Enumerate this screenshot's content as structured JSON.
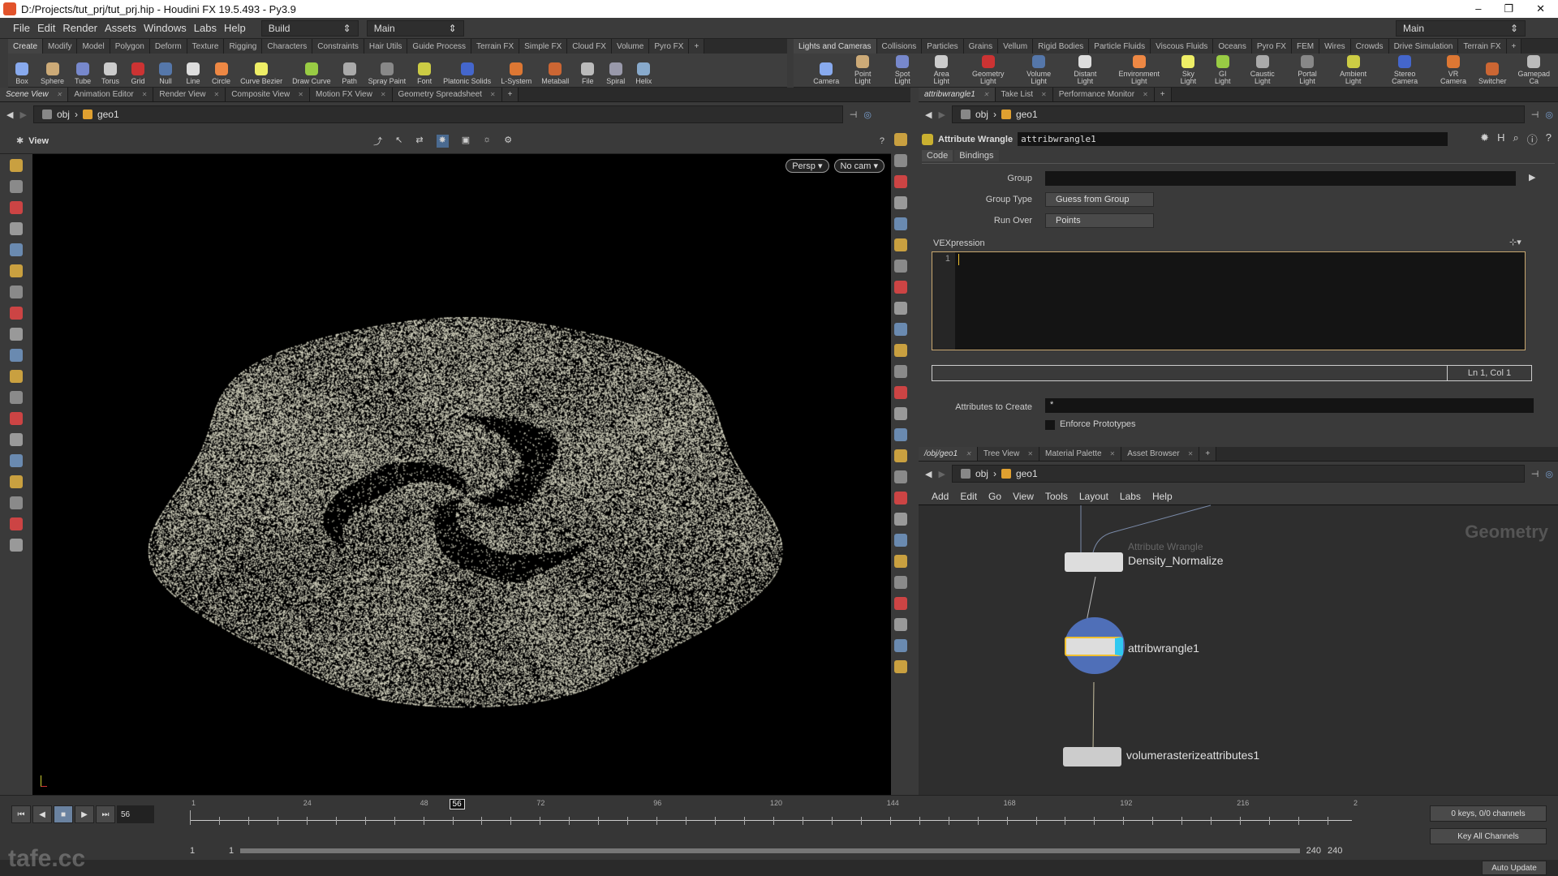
{
  "window": {
    "title": "D:/Projects/tut_prj/tut_prj.hip - Houdini FX 19.5.493 - Py3.9",
    "controls": [
      "–",
      "❐",
      "✕"
    ]
  },
  "menu": [
    "File",
    "Edit",
    "Render",
    "Assets",
    "Windows",
    "Labs",
    "Help"
  ],
  "desktop": "Build",
  "desktop_right": "Main",
  "desktop_far": "Main",
  "shelf_left": {
    "tabs": [
      "Create",
      "Modify",
      "Model",
      "Polygon",
      "Deform",
      "Texture",
      "Rigging",
      "Characters",
      "Constraints",
      "Hair Utils",
      "Guide Process",
      "Terrain FX",
      "Simple FX",
      "Cloud FX",
      "Volume",
      "Pyro FX"
    ],
    "tools": [
      "Box",
      "Sphere",
      "Tube",
      "Torus",
      "Grid",
      "Null",
      "Line",
      "Circle",
      "Curve Bezier",
      "Draw Curve",
      "Path",
      "Spray Paint",
      "Font",
      "Platonic Solids",
      "L-System",
      "Metaball",
      "File",
      "Spiral",
      "Helix"
    ]
  },
  "shelf_right": {
    "tabs": [
      "Lights and Cameras",
      "Collisions",
      "Particles",
      "Grains",
      "Vellum",
      "Rigid Bodies",
      "Particle Fluids",
      "Viscous Fluids",
      "Oceans",
      "Pyro FX",
      "FEM",
      "Wires",
      "Crowds",
      "Drive Simulation",
      "Terrain FX"
    ],
    "tools": [
      "Camera",
      "Point Light",
      "Spot Light",
      "Area Light",
      "Geometry Light",
      "Volume Light",
      "Distant Light",
      "Environment Light",
      "Sky Light",
      "GI Light",
      "Caustic Light",
      "Portal Light",
      "Ambient Light",
      "Stereo Camera",
      "VR Camera",
      "Switcher",
      "Gamepad Ca"
    ]
  },
  "left_pane": {
    "tabs": [
      "Scene View",
      "Animation Editor",
      "Render View",
      "Composite View",
      "Motion FX View",
      "Geometry Spreadsheet"
    ],
    "path": [
      "obj",
      "geo1"
    ],
    "view_label": "View",
    "persp": "Persp ▾",
    "cam": "No cam ▾"
  },
  "param_pane": {
    "tabs": [
      "attribwrangle1",
      "Take List",
      "Performance Monitor"
    ],
    "path": [
      "obj",
      "geo1"
    ],
    "node_type": "Attribute Wrangle",
    "node_name": "attribwrangle1",
    "subtabs": [
      "Code",
      "Bindings"
    ],
    "group_label": "Group",
    "group_value": "",
    "group_type_label": "Group Type",
    "group_type_value": "Guess from Group",
    "run_over_label": "Run Over",
    "run_over_value": "Points",
    "vex_label": "VEXpression",
    "line_number": "1",
    "code": "",
    "cursor_pos": "Ln 1, Col 1",
    "attrs_label": "Attributes to Create",
    "attrs_value": "*",
    "enforce_label": "Enforce Prototypes",
    "enforce_checked": false
  },
  "net_pane": {
    "tabs": [
      "/obj/geo1",
      "Tree View",
      "Material Palette",
      "Asset Browser"
    ],
    "path": [
      "obj",
      "geo1"
    ],
    "menu": [
      "Add",
      "Edit",
      "Go",
      "View",
      "Tools",
      "Layout",
      "Labs",
      "Help"
    ],
    "context": "Geometry",
    "nodes": [
      {
        "type": "Attribute Wrangle",
        "name": "Density_Normalize"
      },
      {
        "name": "attribwrangle1",
        "selected": true
      },
      {
        "name": "volumerasterizeattributes1"
      }
    ]
  },
  "timeline": {
    "current_frame": "56",
    "ticks": [
      "1",
      "24",
      "48",
      "72",
      "96",
      "120",
      "144",
      "168",
      "192",
      "216",
      "2"
    ],
    "start": "1",
    "start2": "1",
    "end": "240",
    "end2": "240",
    "keys": "0 keys, 0/0 channels",
    "key_all": "Key All Channels",
    "auto_update": "Auto Update",
    "range": [
      1,
      240
    ]
  },
  "watermark": "tafe.cc",
  "colors": {
    "accent": "#f0c030",
    "points": "#d7d6c2",
    "selected_ring": "#4f6fb8"
  }
}
